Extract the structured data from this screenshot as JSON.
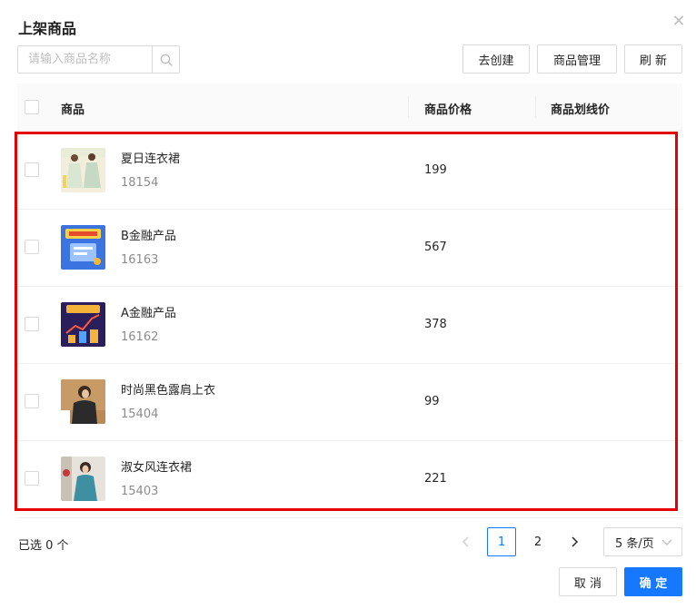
{
  "dialog": {
    "title": "上架商品"
  },
  "search": {
    "placeholder": "请输入商品名称",
    "value": ""
  },
  "toolbar": {
    "create_label": "去创建",
    "manage_label": "商品管理",
    "refresh_label": "刷 新"
  },
  "table": {
    "columns": [
      "商品",
      "商品价格",
      "商品划线价"
    ],
    "rows": [
      {
        "name": "夏日连衣裙",
        "id": "18154",
        "price": "199",
        "strike_price": "",
        "thumb": "dress-summer"
      },
      {
        "name": "B金融产品",
        "id": "16163",
        "price": "567",
        "strike_price": "",
        "thumb": "finance-b"
      },
      {
        "name": "A金融产品",
        "id": "16162",
        "price": "378",
        "strike_price": "",
        "thumb": "finance-a"
      },
      {
        "name": "时尚黑色露肩上衣",
        "id": "15404",
        "price": "99",
        "strike_price": "",
        "thumb": "fashion-top"
      },
      {
        "name": "淑女风连衣裙",
        "id": "15403",
        "price": "221",
        "strike_price": "",
        "thumb": "dress-lady"
      }
    ]
  },
  "footer": {
    "selected_text": "已选 0 个"
  },
  "pagination": {
    "current": "1",
    "page2": "2",
    "page_size": "5 条/页"
  },
  "actions": {
    "cancel_label": "取 消",
    "ok_label": "确 定"
  },
  "colors": {
    "primary": "#1677ff",
    "highlight": "#e60000"
  }
}
